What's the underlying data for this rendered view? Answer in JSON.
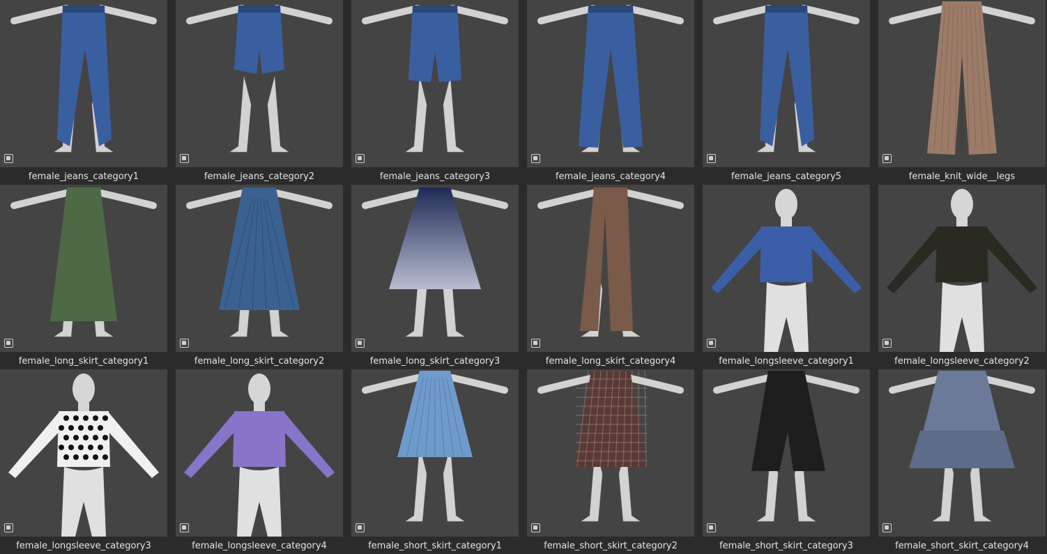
{
  "assets": [
    {
      "name": "female_jeans_category1",
      "kind": "jeans-full",
      "color": "#3a5fa0"
    },
    {
      "name": "female_jeans_category2",
      "kind": "jeans-shorts",
      "color": "#3a5fa0"
    },
    {
      "name": "female_jeans_category3",
      "kind": "jeans-bermuda",
      "color": "#3a5fa0"
    },
    {
      "name": "female_jeans_category4",
      "kind": "jeans-wide",
      "color": "#3a5fa0"
    },
    {
      "name": "female_jeans_category5",
      "kind": "jeans-straight",
      "color": "#3a5fa0"
    },
    {
      "name": "female_knit_wide__legs",
      "kind": "knit-wide",
      "color": "#9c7c68"
    },
    {
      "name": "female_long_skirt_category1",
      "kind": "long-skirt",
      "color": "#4e6a45"
    },
    {
      "name": "female_long_skirt_category2",
      "kind": "long-skirt-flare",
      "color": "#3a6190"
    },
    {
      "name": "female_long_skirt_category3",
      "kind": "long-skirt-gradient",
      "color": "#2a3a66"
    },
    {
      "name": "female_long_skirt_category4",
      "kind": "long-skirt-slit",
      "color": "#7a5a48"
    },
    {
      "name": "female_longsleeve_category1",
      "kind": "longsleeve",
      "color": "#3a5fa8"
    },
    {
      "name": "female_longsleeve_category2",
      "kind": "longsleeve",
      "color": "#2b2a22"
    },
    {
      "name": "female_longsleeve_category3",
      "kind": "longsleeve-dots",
      "color": "#f0f0f0"
    },
    {
      "name": "female_longsleeve_category4",
      "kind": "longsleeve-blouse",
      "color": "#8874c8"
    },
    {
      "name": "female_short_skirt_category1",
      "kind": "short-skirt-pleated",
      "color": "#6f9bcc"
    },
    {
      "name": "female_short_skirt_category2",
      "kind": "short-skirt-plaid",
      "color": "#5a3a36"
    },
    {
      "name": "female_short_skirt_category3",
      "kind": "short-skirt-slit",
      "color": "#1e1e1e"
    },
    {
      "name": "female_short_skirt_category4",
      "kind": "short-skirt-ruffle",
      "color": "#6a7a98"
    }
  ],
  "icons": {
    "badge": "asset-type-icon"
  }
}
